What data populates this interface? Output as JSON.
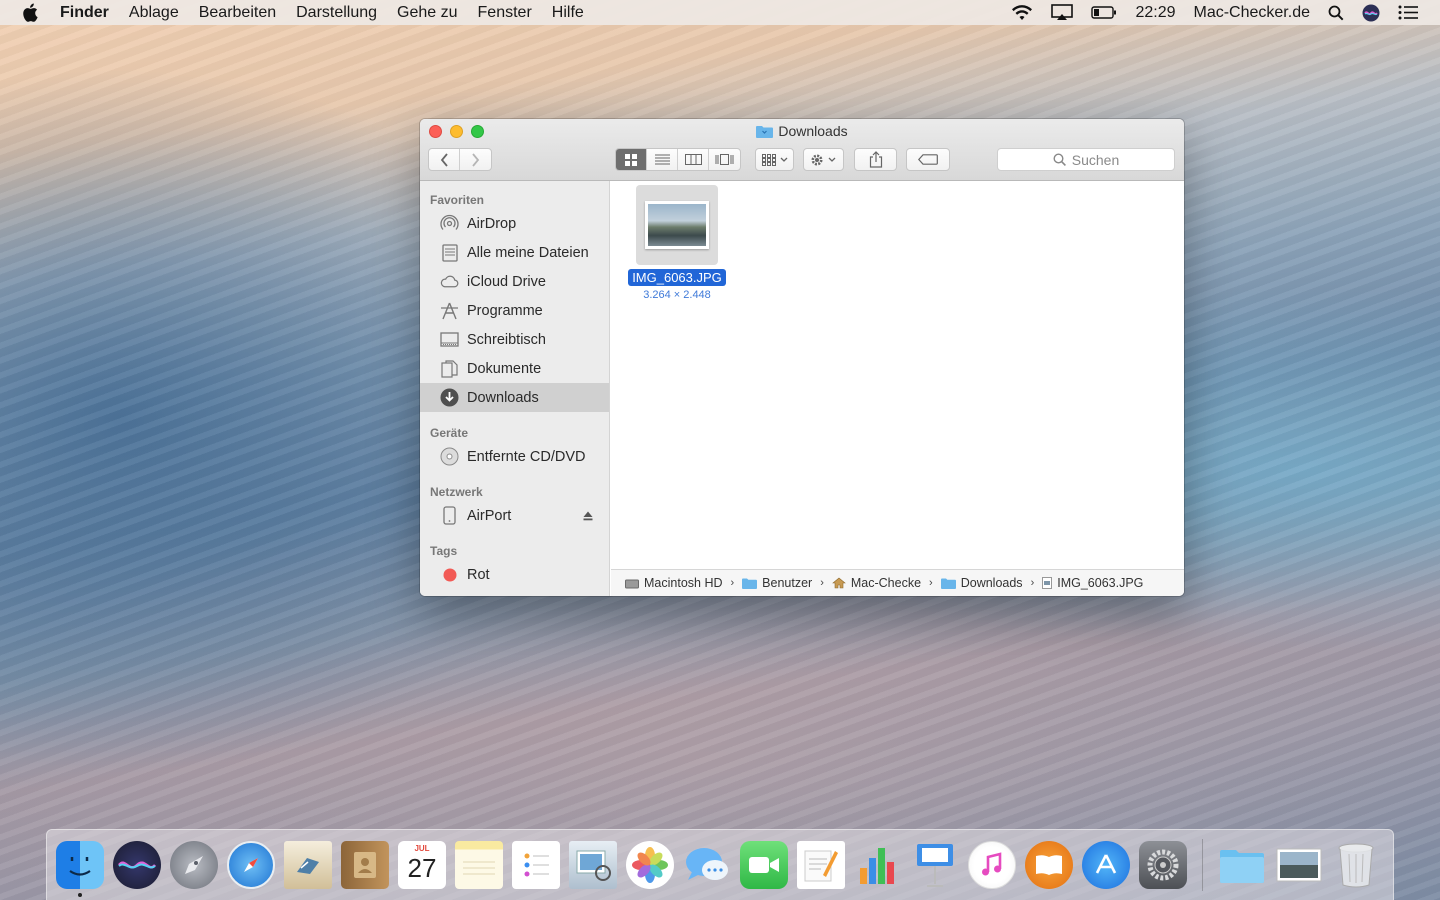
{
  "menubar": {
    "app_name": "Finder",
    "menus": [
      "Ablage",
      "Bearbeiten",
      "Darstellung",
      "Gehe zu",
      "Fenster",
      "Hilfe"
    ],
    "clock": "22:29",
    "user": "Mac-Checker.de"
  },
  "window": {
    "title": "Downloads",
    "search_placeholder": "Suchen",
    "sidebar": {
      "favorites_header": "Favoriten",
      "favorites": [
        {
          "label": "AirDrop",
          "icon": "airdrop-icon"
        },
        {
          "label": "Alle meine Dateien",
          "icon": "all-files-icon"
        },
        {
          "label": "iCloud Drive",
          "icon": "cloud-icon"
        },
        {
          "label": "Programme",
          "icon": "applications-icon"
        },
        {
          "label": "Schreibtisch",
          "icon": "desktop-icon"
        },
        {
          "label": "Dokumente",
          "icon": "documents-icon"
        },
        {
          "label": "Downloads",
          "icon": "download-icon",
          "selected": true
        }
      ],
      "devices_header": "Geräte",
      "devices": [
        {
          "label": "Entfernte CD/DVD",
          "icon": "disc-icon"
        }
      ],
      "network_header": "Netzwerk",
      "network": [
        {
          "label": "AirPort",
          "icon": "airport-icon"
        }
      ],
      "tags_header": "Tags",
      "tags": [
        {
          "label": "Rot",
          "color": "#f25a55"
        }
      ]
    },
    "files": [
      {
        "name": "IMG_6063.JPG",
        "dimensions": "3.264 × 2.448"
      }
    ],
    "path": [
      "Macintosh HD",
      "Benutzer",
      "Mac-Checke",
      "Downloads",
      "IMG_6063.JPG"
    ]
  },
  "dock": {
    "apps": [
      {
        "name": "finder-icon",
        "color": "#3a9bf0"
      },
      {
        "name": "siri-icon",
        "color": "#23253a"
      },
      {
        "name": "launchpad-icon",
        "color": "#8a8f99"
      },
      {
        "name": "safari-icon",
        "color": "#2f8de3"
      },
      {
        "name": "mail-icon",
        "color": "#d9c7a0"
      },
      {
        "name": "contacts-icon",
        "color": "#b08654"
      },
      {
        "name": "calendar-icon",
        "color": "#ffffff"
      },
      {
        "name": "notes-icon",
        "color": "#f8e585"
      },
      {
        "name": "reminders-icon",
        "color": "#ffffff"
      },
      {
        "name": "preview-icon",
        "color": "#cfd9e3"
      },
      {
        "name": "photos-icon",
        "color": "#ffffff"
      },
      {
        "name": "messages-icon",
        "color": "#58a9f5"
      },
      {
        "name": "facetime-icon",
        "color": "#3ccf4d"
      },
      {
        "name": "pages-icon",
        "color": "#f39c32"
      },
      {
        "name": "numbers-icon",
        "color": "#3fbf55"
      },
      {
        "name": "keynote-icon",
        "color": "#3d8ee6"
      },
      {
        "name": "itunes-icon",
        "color": "#ffffff"
      },
      {
        "name": "ibooks-icon",
        "color": "#f18a1c"
      },
      {
        "name": "app-store-icon",
        "color": "#2a8ff0"
      },
      {
        "name": "system-preferences-icon",
        "color": "#6d6f74"
      }
    ],
    "stacks": [
      {
        "name": "downloads-stack-icon",
        "color": "#5eb5ec"
      },
      {
        "name": "image-stack-icon",
        "color": "#e8ecef"
      },
      {
        "name": "trash-icon",
        "color": "#d6d9dc"
      }
    ],
    "calendar_day": "27",
    "calendar_month": "JUL"
  }
}
